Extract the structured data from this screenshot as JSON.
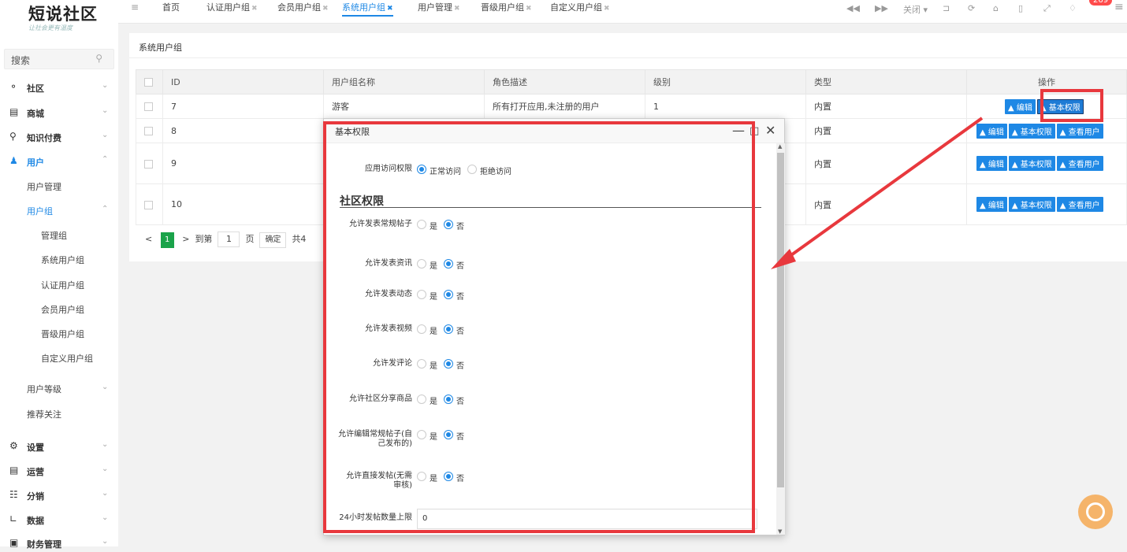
{
  "logo": {
    "title": "短说社区",
    "slogan": "让社会更有温度"
  },
  "sidebar": {
    "search_placeholder": "搜索",
    "items": [
      {
        "label": "社区",
        "icon": "chat-icon"
      },
      {
        "label": "商城",
        "icon": "shop-icon"
      },
      {
        "label": "知识付费",
        "icon": "pin-icon"
      },
      {
        "label": "用户",
        "icon": "users-icon"
      },
      {
        "label": "设置",
        "icon": "gear-icon"
      },
      {
        "label": "运营",
        "icon": "operation-icon"
      },
      {
        "label": "分销",
        "icon": "network-icon"
      },
      {
        "label": "数据",
        "icon": "chart-icon"
      },
      {
        "label": "财务管理",
        "icon": "finance-icon"
      }
    ],
    "user_sub": {
      "manage": "用户管理",
      "group": "用户组",
      "level": "用户等级",
      "follow": "推荐关注"
    },
    "group_sub": [
      "管理组",
      "系统用户组",
      "认证用户组",
      "会员用户组",
      "晋级用户组",
      "自定义用户组"
    ]
  },
  "topbar": {
    "tabs": [
      "首页",
      "认证用户组",
      "会员用户组",
      "系统用户组",
      "用户管理",
      "晋级用户组",
      "自定义用户组"
    ],
    "active_tab": "系统用户组",
    "close_label": "关闭",
    "badge": "269"
  },
  "page": {
    "title": "系统用户组",
    "columns": [
      "ID",
      "用户组名称",
      "角色描述",
      "级别",
      "类型",
      "操作"
    ],
    "rows": [
      {
        "id": "7",
        "name": "游客",
        "desc": "所有打开应用,未注册的用户",
        "level": "1",
        "type": "内置"
      },
      {
        "id": "8",
        "name": "",
        "desc": "",
        "level": "",
        "type": "内置"
      },
      {
        "id": "9",
        "name": "",
        "desc": "",
        "level": "",
        "type": "内置"
      },
      {
        "id": "10",
        "name": "",
        "desc": "",
        "level": "",
        "type": "内置"
      }
    ],
    "btn_edit": "编辑",
    "btn_perm": "基本权限",
    "btn_view": "查看用户"
  },
  "pager": {
    "current": "1",
    "goto": "到第",
    "page_input": "1",
    "page_unit": "页",
    "confirm": "确定",
    "total": "共4"
  },
  "dialog": {
    "title": "基本权限",
    "access_label": "应用访问权限",
    "access_normal": "正常访问",
    "access_deny": "拒绝访问",
    "section": "社区权限",
    "yes": "是",
    "no": "否",
    "perms": [
      "允许发表常规帖子",
      "允许发表资讯",
      "允许发表动态",
      "允许发表视频",
      "允许发评论",
      "允许社区分享商品",
      "允许编辑常规帖子(自己发布的)",
      "允许直接发帖(无需审核)"
    ],
    "limit_label": "24小时发帖数量上限",
    "limit_value": "0"
  }
}
